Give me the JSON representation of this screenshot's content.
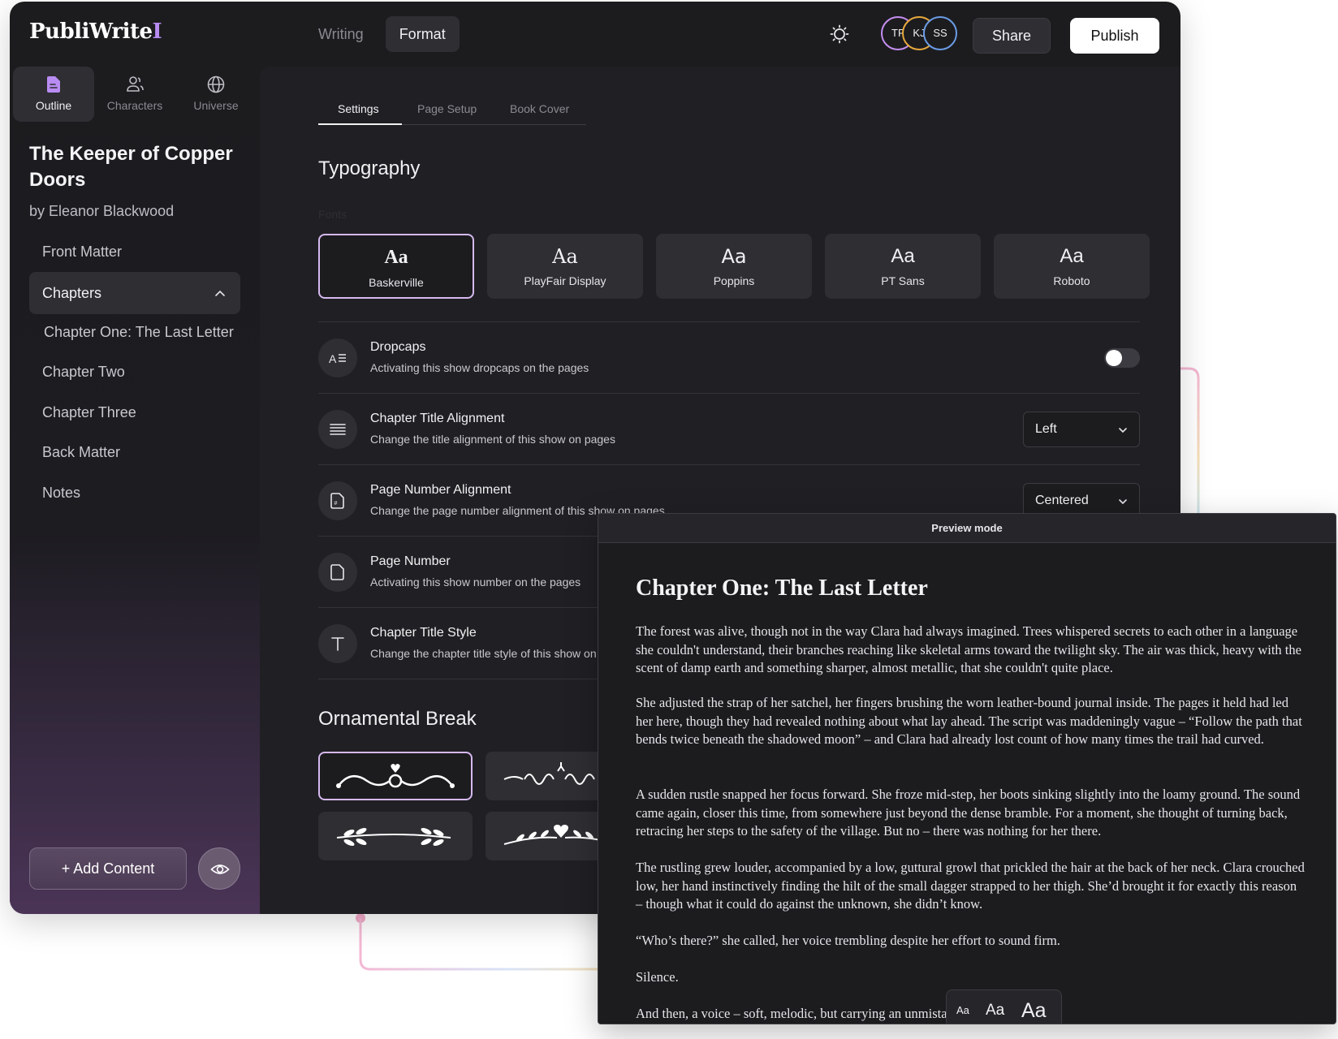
{
  "app": {
    "logo": "PubliWrite",
    "logo_mark": "I",
    "mode_tabs": [
      "Writing",
      "Format"
    ],
    "active_mode": "Format",
    "avatars": [
      {
        "initials": "TF",
        "color": "#c58ef0"
      },
      {
        "initials": "KJ",
        "color": "#e9a93c"
      },
      {
        "initials": "SS",
        "color": "#6b9ce6"
      }
    ],
    "share_label": "Share",
    "publish_label": "Publish"
  },
  "sidebar": {
    "tabs": [
      {
        "label": "Outline",
        "icon": "document-icon",
        "active": true
      },
      {
        "label": "Characters",
        "icon": "users-icon",
        "active": false
      },
      {
        "label": "Universe",
        "icon": "globe-icon",
        "active": false
      }
    ],
    "book_title": "The Keeper of Copper Doors",
    "book_author": "by Eleanor Blackwood",
    "outline": [
      {
        "label": "Front Matter"
      },
      {
        "label": "Chapters",
        "expanded": true
      },
      {
        "label": "Chapter One: The Last Letter"
      },
      {
        "label": "Chapter Two"
      },
      {
        "label": "Chapter Three"
      },
      {
        "label": "Back Matter"
      },
      {
        "label": "Notes"
      }
    ],
    "add_content_label": "+ Add Content",
    "preview_icon": "eye-icon"
  },
  "settings": {
    "tabs": [
      "Settings",
      "Page Setup",
      "Book Cover"
    ],
    "active_tab": "Settings",
    "typography_title": "Typography",
    "fonts_label": "Fonts",
    "fonts": [
      {
        "sample": "Aa",
        "name": "Baskerville",
        "selected": true
      },
      {
        "sample": "Aa",
        "name": "PlayFair Display",
        "selected": false
      },
      {
        "sample": "Aa",
        "name": "Poppins",
        "selected": false
      },
      {
        "sample": "Aa",
        "name": "PT Sans",
        "selected": false
      },
      {
        "sample": "Aa",
        "name": "Roboto",
        "selected": false
      }
    ],
    "rows": [
      {
        "title": "Dropcaps",
        "desc": "Activating this show dropcaps on the pages",
        "control": "toggle",
        "value": "off"
      },
      {
        "title": "Chapter Title Alignment",
        "desc": "Change the title alignment of this show on pages",
        "control": "select",
        "value": "Left"
      },
      {
        "title": "Page Number Alignment",
        "desc": "Change the page number alignment of this show on pages",
        "control": "select",
        "value": "Centered"
      },
      {
        "title": "Page Number",
        "desc": "Activating this show number on the pages",
        "control": "none"
      },
      {
        "title": "Chapter Title Style",
        "desc": "Change the chapter title style of this show on pages",
        "control": "none"
      }
    ],
    "ornamental_title": "Ornamental Break"
  },
  "preview": {
    "header": "Preview mode",
    "chapter_title": "Chapter One: The Last Letter",
    "paragraphs": [
      "The forest was alive, though not in the way Clara had always imagined. Trees whispered secrets to each other in a language she couldn't understand, their branches reaching like skeletal arms toward the twilight sky. The air was thick, heavy with the scent of damp earth and something sharper, almost metallic, that she couldn't quite place.",
      "She adjusted the strap of her satchel, her fingers brushing the worn leather-bound journal inside. The pages it held had led her here, though they had revealed nothing about what lay ahead. The script was maddeningly vague – “Follow the path that bends twice beneath the shadowed moon” – and Clara had already lost count of how many times the trail had curved.",
      "A sudden rustle snapped her focus forward. She froze mid-step, her boots sinking slightly into the loamy ground. The sound came again, closer this time, from somewhere just beyond the dense bramble. For a moment, she thought of turning back, retracing her steps to the safety of the village. But no – there was nothing for her there.",
      "The rustling grew louder, accompanied by a low, guttural growl that prickled the hair at the back of her neck. Clara crouched low, her hand instinctively finding the hilt of the small dagger strapped to her thigh. She’d brought it for exactly this reason – though what it could do against the unknown, she didn’t know.",
      "“Who’s there?” she called, her voice trembling despite her effort to sound firm.",
      "Silence.",
      "And then, a voice – soft, melodic, but carrying an unmistakable edge."
    ],
    "size_options": [
      "Aa",
      "Aa",
      "Aa"
    ]
  }
}
